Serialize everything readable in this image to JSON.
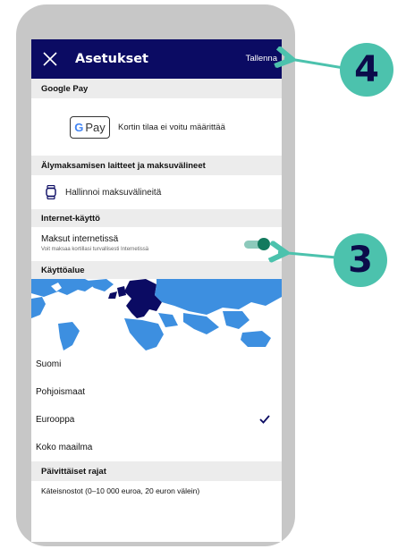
{
  "appbar": {
    "title": "Asetukset",
    "save_label": "Tallenna"
  },
  "google_pay": {
    "header": "Google Pay",
    "badge_g": "G",
    "badge_pay": "Pay",
    "status": "Kortin tilaa ei voitu määrittää"
  },
  "smart_payment": {
    "header": "Älymaksamisen laitteet ja maksuvälineet",
    "manage_label": "Hallinnoi maksuvälineitä"
  },
  "internet_use": {
    "header": "Internet-käyttö",
    "toggle_title": "Maksut internetissä",
    "toggle_subtitle": "Voit maksaa kortillasi turvallisesti Internetissä",
    "toggle_on": true
  },
  "usage_area": {
    "header": "Käyttöalue",
    "options": [
      "Suomi",
      "Pohjoismaat",
      "Eurooppa",
      "Koko maailma"
    ],
    "selected": "Eurooppa"
  },
  "daily_limits": {
    "header": "Päivittäiset rajat",
    "cash_label": "Käteisnostot (0–10 000 euroa, 20 euron välein)"
  },
  "callouts": {
    "four": "4",
    "three": "3"
  },
  "colors": {
    "appbar": "#0b0b63",
    "callout": "#4cc2ad",
    "toggle_knob": "#137a5e",
    "map_ocean": "#3d8fe0",
    "map_highlight": "#0b0b63"
  }
}
